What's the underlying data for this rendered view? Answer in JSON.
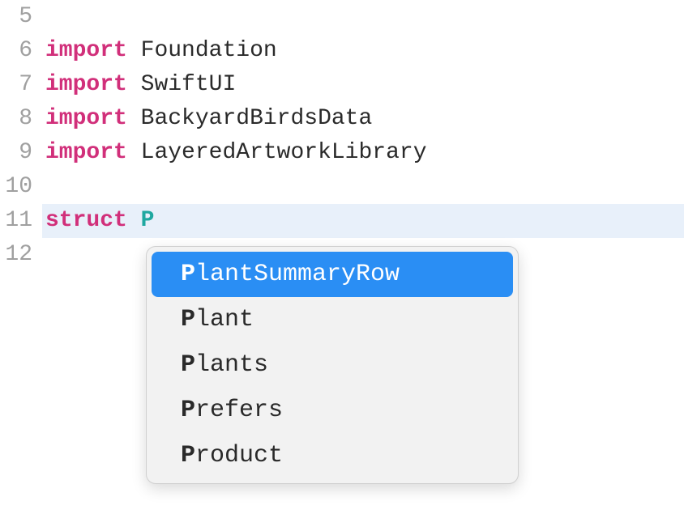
{
  "gutter": {
    "lines": [
      "5",
      "6",
      "7",
      "8",
      "9",
      "10",
      "11",
      "12"
    ]
  },
  "code": {
    "import_kw": "import",
    "struct_kw": "struct",
    "typed_char": "P",
    "imports": [
      "Foundation",
      "SwiftUI",
      "BackyardBirdsData",
      "LayeredArtworkLibrary"
    ]
  },
  "autocomplete": {
    "items": [
      {
        "match": "P",
        "rest": "lantSummaryRow",
        "selected": true
      },
      {
        "match": "P",
        "rest": "lant",
        "selected": false
      },
      {
        "match": "P",
        "rest": "lants",
        "selected": false
      },
      {
        "match": "P",
        "rest": "refers",
        "selected": false
      },
      {
        "match": "P",
        "rest": "roduct",
        "selected": false
      }
    ]
  }
}
